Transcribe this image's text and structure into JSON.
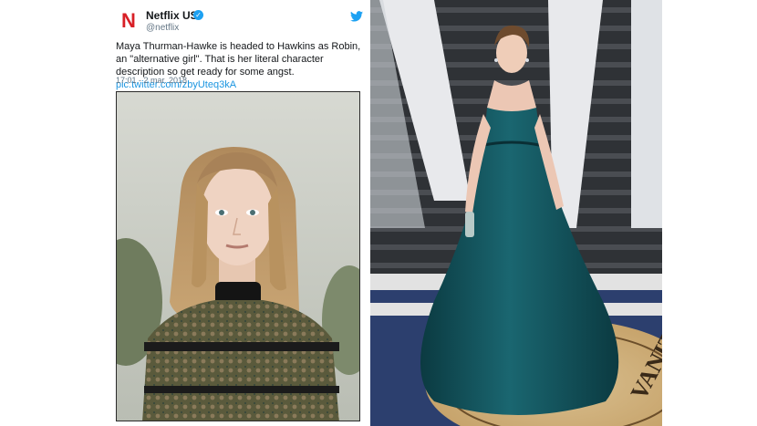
{
  "tweet": {
    "account_name": "Netflix US",
    "handle": "@netflix",
    "avatar_letter": "N",
    "text": "Maya Thurman-Hawke is headed to Hawkins as Robin, an \"alternative girl\". That is her literal character description so get ready for some angst.",
    "link": "pic.twitter.com/zbyUteq3kA",
    "timestamp": "17:01 - 2 mar. 2018"
  },
  "carpet_photo": {
    "backdrop_letter": "V",
    "rug_text": "VANITY FA"
  },
  "colors": {
    "netflix_red": "#d81f26",
    "twitter_blue": "#1da1f2",
    "link_blue": "#1b95e0",
    "gown_teal": "#0f4a52"
  }
}
